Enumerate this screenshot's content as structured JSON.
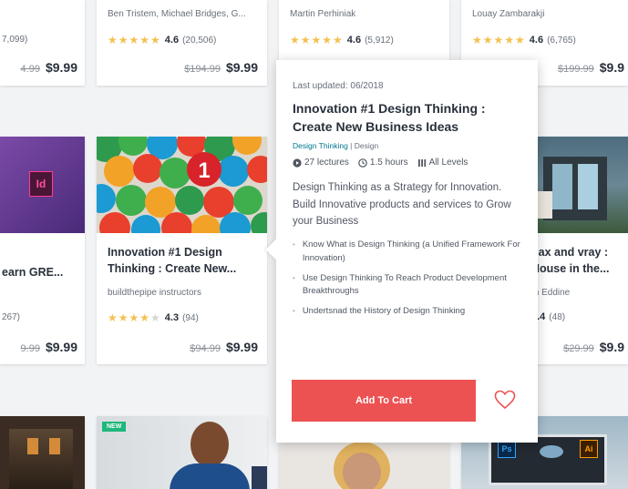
{
  "row1": [
    {
      "instructor": "",
      "rating": "",
      "count": "7,099)",
      "old_price": "4.99",
      "price": "$9.99"
    },
    {
      "instructor": "Ben Tristem, Michael Bridges, G...",
      "rating": "4.6",
      "count": "(20,506)",
      "old_price": "$194.99",
      "price": "$9.99"
    },
    {
      "instructor": "Martin Perhiniak",
      "rating": "4.6",
      "count": "(5,912)"
    },
    {
      "instructor": "Louay Zambarakji",
      "rating": "4.6",
      "count": "(6,765)",
      "old_price": "$199.99",
      "price": "$9.9"
    }
  ],
  "row2": [
    {
      "title": "earn GRE...",
      "count": "267)",
      "old_price": "9.99",
      "price": "$9.99",
      "thumb_icon": "Id"
    },
    {
      "title": "Innovation #1 Design Thinking : Create New...",
      "instructor": "buildthepipe instructors",
      "rating": "4.3",
      "count": "(94)",
      "old_price": "$94.99",
      "price": "$9.99"
    },
    {
      "title": "nax and vray : House in the...",
      "instructor": "m Eddine",
      "rating": "4.4",
      "count": "(48)",
      "old_price": "$29.99",
      "price": "$9.9"
    }
  ],
  "row3": {
    "badge": "NEW",
    "ps_icon": "Ps",
    "ai_icon": "Ai"
  },
  "popup": {
    "updated": "Last updated: 06/2018",
    "title": "Innovation #1 Design Thinking : Create New Business Ideas",
    "category": "Design Thinking",
    "separator": "|",
    "subcategory": "Design",
    "lectures": "27 lectures",
    "hours": "1.5 hours",
    "level": "All Levels",
    "description": "Design Thinking as a Strategy for Innovation. Build Innovative products and services to Grow your Business",
    "bullets": [
      "Know What is Design Thinking (a Unified Framework For Innovation)",
      "Use Design Thinking To Reach Product Development Breakthroughs",
      "Undertsnad the History of Design Thinking"
    ],
    "cart_label": "Add To Cart"
  },
  "colors": {
    "accent": "#ec5252",
    "star": "#f4c150",
    "link": "#007791"
  }
}
